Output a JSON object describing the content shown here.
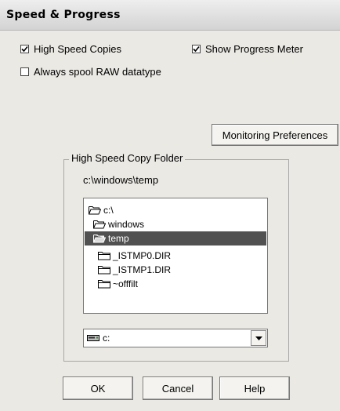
{
  "dialog": {
    "title": "Speed & Progress"
  },
  "options": {
    "high_speed_copies": {
      "label": "High Speed Copies",
      "checked": true
    },
    "show_progress_meter": {
      "label": "Show Progress Meter",
      "checked": true
    },
    "always_spool_raw": {
      "label": "Always spool RAW datatype",
      "checked": false
    }
  },
  "monitoring_button": "Monitoring Preferences",
  "folder_group": {
    "legend": "High Speed Copy Folder",
    "current_path": "c:\\windows\\temp",
    "tree": [
      {
        "label": "c:\\",
        "icon": "open-folder-icon"
      },
      {
        "label": "windows",
        "icon": "open-folder-icon"
      },
      {
        "label": "temp",
        "icon": "open-folder-icon",
        "selected": true
      },
      {
        "label": "_ISTMP0.DIR",
        "icon": "folder-icon"
      },
      {
        "label": "_ISTMP1.DIR",
        "icon": "folder-icon"
      },
      {
        "label": "~offfilt",
        "icon": "folder-icon"
      }
    ],
    "drive": {
      "value": "c:",
      "icon": "drive-icon"
    }
  },
  "buttons": {
    "ok": "OK",
    "cancel": "Cancel",
    "help": "Help"
  }
}
